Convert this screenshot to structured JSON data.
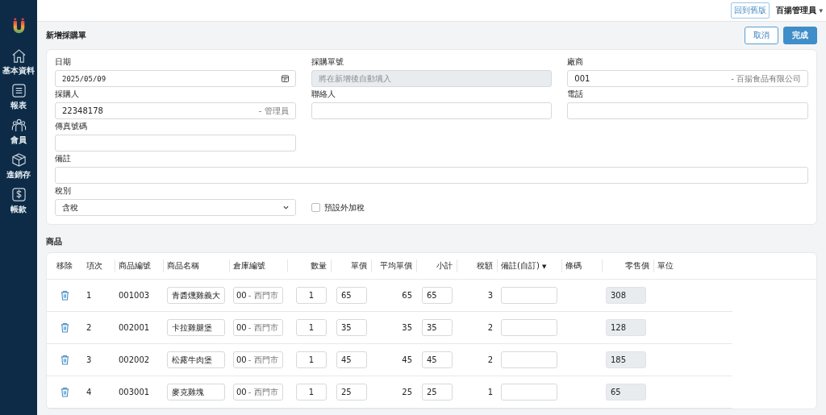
{
  "sidebar": {
    "items": [
      {
        "label": "基本資料"
      },
      {
        "label": "報表"
      },
      {
        "label": "會員"
      },
      {
        "label": "進銷存"
      },
      {
        "label": "帳款"
      }
    ]
  },
  "topbar": {
    "legacy_button": "回到舊版",
    "user": "百揚管理員",
    "user_caret": "▾"
  },
  "page": {
    "title": "新增採購單",
    "buttons": [
      {
        "label": "取消",
        "kind": "secondary"
      },
      {
        "label": "完成",
        "kind": "primary"
      }
    ]
  },
  "form": {
    "fields": [
      {
        "label": "日期",
        "kind": "date",
        "value": "2025/05/09"
      },
      {
        "label": "採購單號",
        "kind": "readonly",
        "placeholder": "將在新增後自動填入"
      },
      {
        "label": "廠商",
        "kind": "text",
        "value": "001",
        "suffix": "- 百揚食品有限公司"
      },
      {
        "label": "採購人",
        "kind": "text",
        "value": "22348178",
        "suffix": "- 管理員"
      },
      {
        "label": "聯絡人",
        "kind": "text"
      },
      {
        "label": "電話",
        "kind": "text"
      },
      {
        "label": "傳真號碼",
        "kind": "text"
      },
      {
        "label": "備註",
        "kind": "wide"
      },
      {
        "label": "稅別",
        "kind": "select",
        "value": "含稅"
      },
      {
        "label": "預設外加稅",
        "kind": "checkbox",
        "checked": false
      }
    ]
  },
  "products": {
    "title": "商品",
    "columns": [
      "移除",
      "項次",
      "商品編號",
      "商品名稱",
      "倉庫編號",
      "數量",
      "單價",
      "平均單價",
      "小計",
      "稅額",
      "備註(自訂)",
      "條碼",
      "零售價",
      "單位"
    ],
    "remark_caret": "▼",
    "rows": [
      {
        "index": "1",
        "code": "001003",
        "name": "青醬燻雞義大",
        "warehouse": "00",
        "warehouse_suffix": "- 西門市",
        "qty": "1",
        "price": "65",
        "avg_price": "65",
        "subtotal": "65",
        "tax": "3",
        "retail": "308"
      },
      {
        "index": "2",
        "code": "002001",
        "name": "卡拉雞腿堡",
        "warehouse": "00",
        "warehouse_suffix": "- 西門市",
        "qty": "1",
        "price": "35",
        "avg_price": "35",
        "subtotal": "35",
        "tax": "2",
        "retail": "128"
      },
      {
        "index": "3",
        "code": "002002",
        "name": "松露牛肉堡",
        "warehouse": "00",
        "warehouse_suffix": "- 西門市",
        "qty": "1",
        "price": "45",
        "avg_price": "45",
        "subtotal": "45",
        "tax": "2",
        "retail": "185"
      },
      {
        "index": "4",
        "code": "003001",
        "name": "麥克雞塊",
        "warehouse": "00",
        "warehouse_suffix": "- 西門市",
        "qty": "1",
        "price": "25",
        "avg_price": "25",
        "subtotal": "25",
        "tax": "1",
        "retail": "65"
      }
    ]
  }
}
